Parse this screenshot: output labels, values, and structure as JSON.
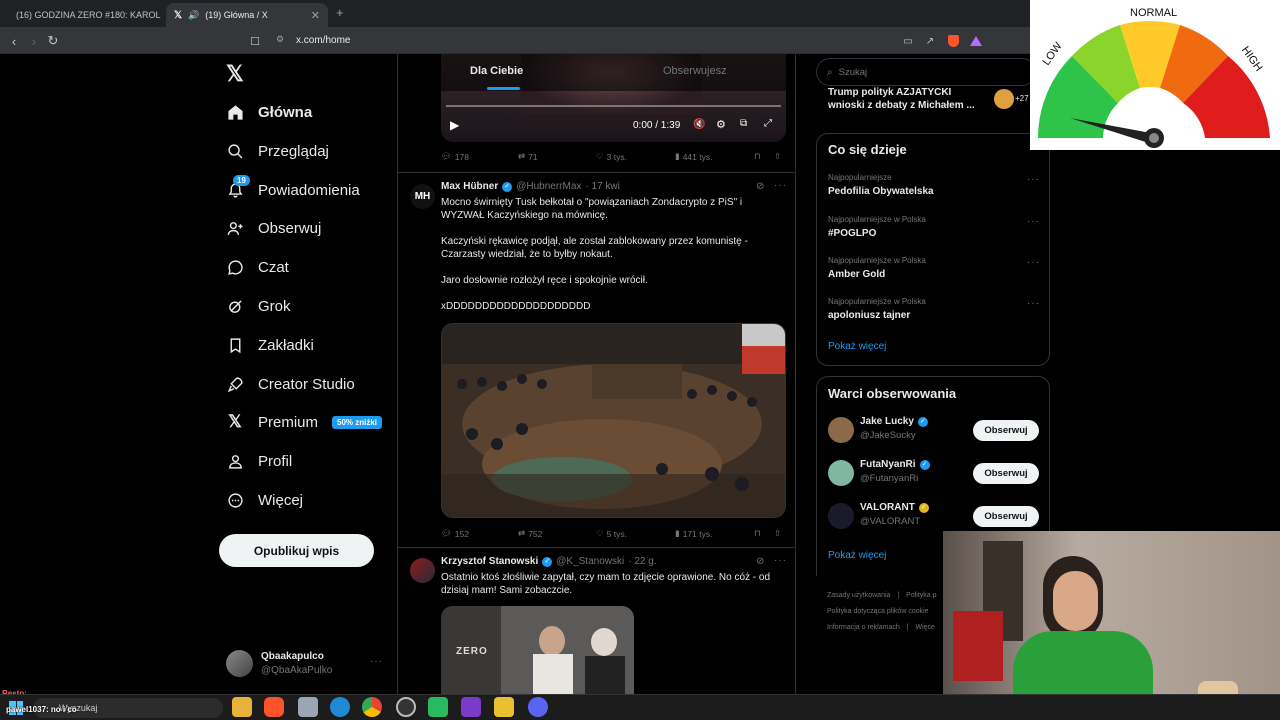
{
  "browser": {
    "tabs": [
      {
        "title": "(16) GODZINA ZERO #180: KAROL N"
      },
      {
        "title": "(19) Główna / X"
      }
    ],
    "url": "x.com/home",
    "new_tab": "+"
  },
  "sidebar": {
    "items": [
      {
        "label": "Główna",
        "icon": "home-icon"
      },
      {
        "label": "Przeglądaj",
        "icon": "search-icon"
      },
      {
        "label": "Powiadomienia",
        "icon": "bell-icon",
        "badge": "19"
      },
      {
        "label": "Obserwuj",
        "icon": "add-user-icon"
      },
      {
        "label": "Czat",
        "icon": "chat-icon"
      },
      {
        "label": "Grok",
        "icon": "grok-icon"
      },
      {
        "label": "Zakładki",
        "icon": "bookmark-icon"
      },
      {
        "label": "Creator Studio",
        "icon": "rocket-icon"
      },
      {
        "label": "Premium",
        "icon": "x-logo-icon",
        "badge": "50% zniżki"
      },
      {
        "label": "Profil",
        "icon": "user-icon"
      },
      {
        "label": "Więcej",
        "icon": "more-circle-icon"
      }
    ],
    "post_button": "Opublikuj wpis",
    "account": {
      "name": "Qbaakapulco",
      "handle": "@QbaAkaPulko"
    }
  },
  "feed": {
    "tabs": [
      "Dla Ciebie",
      "Obserwujesz"
    ],
    "video": {
      "time": "0:00 / 1:39"
    },
    "tweet0_actions": {
      "replies": "178",
      "retweets": "71",
      "likes": "3 tys.",
      "views": "441 tys."
    },
    "tweet1": {
      "avatar_text": "MH",
      "name": "Max Hübner",
      "handle": "@HubnerrMax",
      "date": "· 17 kwi",
      "para1": "Mocno świrnięty Tusk bełkotał o \"powiązaniach Zondacrypto z PiS\" i WYZWAŁ Kaczyńskiego na mównicę.",
      "para2": "Kaczyński rękawicę podjął, ale został zablokowany przez komunistę - Czarzasty wiedział, że to byłby nokaut.",
      "para3": "Jaro dosłownie rozłożył ręce i spokojnie wrócił.",
      "para4": "xDDDDDDDDDDDDDDDDDDDD",
      "actions": {
        "replies": "152",
        "retweets": "752",
        "likes": "5 tys.",
        "views": "171 tys."
      }
    },
    "tweet2": {
      "name": "Krzysztof Stanowski",
      "handle": "@K_Stanowski",
      "date": "· 22 g.",
      "text": "Ostatnio ktoś złośliwie zapytał, czy mam to zdjęcie oprawione. No cóż - od dzisiaj mam! Sami zobaczcie.",
      "image_text": "ZERO"
    }
  },
  "right": {
    "search_placeholder": "Szukaj",
    "top_trend": {
      "line1": "Trump polityk AZJATYCKI",
      "line2": "wnioski z debaty z Michałem ...",
      "count": "+27"
    },
    "trends_title": "Co się dzieje",
    "trends": [
      {
        "category": "Najpopularniejsze",
        "name": "Pedofilia Obywatelska"
      },
      {
        "category": "Najpopularniejsze w Polska",
        "name": "#POGLPO"
      },
      {
        "category": "Najpopularniejsze w Polska",
        "name": "Amber Gold"
      },
      {
        "category": "Najpopularniejsze w Polska",
        "name": "apoloniusz tajner"
      }
    ],
    "show_more": "Pokaż więcej",
    "who_title": "Warci obserwowania",
    "who": [
      {
        "name": "Jake Lucky",
        "handle": "@JakeSucky",
        "color": "#8a6a4a"
      },
      {
        "name": "FutaNyanRi",
        "handle": "@FutanyanRi",
        "color": "#7fb7a0"
      },
      {
        "name": "VALORANT",
        "handle": "@VALORANT",
        "color": "#1a1a2a"
      }
    ],
    "follow": "Obserwuj",
    "who_more": "Pokaż więcej",
    "footer": [
      "Zasady użytkowania",
      "|",
      "Polityka p",
      "Polityka dotycząca plików cookie",
      "Informacja o reklamach",
      "|",
      "Więce"
    ]
  },
  "gauge": {
    "labels": [
      "LOW",
      "NORMAL",
      "HIGH"
    ],
    "level": 0.1
  },
  "overlay": {
    "line1": "Resto:",
    "line2": "pawel1037: no i co"
  },
  "taskbar": {
    "search": "Wyszukaj"
  }
}
